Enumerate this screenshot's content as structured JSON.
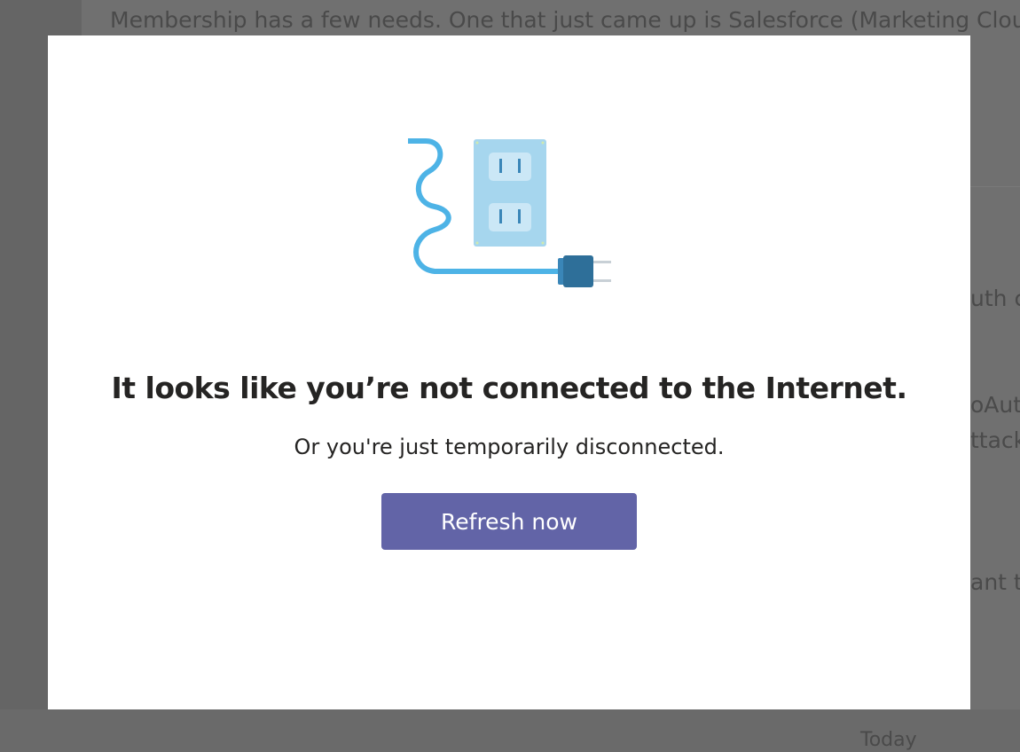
{
  "background": {
    "top_text": "Membership has a few needs. One that just came up is Salesforce (Marketing Cloud",
    "side_fragments": [
      "uth c",
      "oAut",
      "ttack",
      "ant t"
    ],
    "footer_text": "Today"
  },
  "dialog": {
    "illustration_icon": "unplugged-cable-icon",
    "title": "It looks like you’re not connected to the Internet.",
    "subtitle": "Or you're just temporarily disconnected.",
    "refresh_label": "Refresh now"
  },
  "colors": {
    "accent": "#6264A7",
    "overlay": "#6E6E6E",
    "cable": "#4DB3E6",
    "outlet": "#A0D4EC",
    "plug": "#2E6F99"
  }
}
